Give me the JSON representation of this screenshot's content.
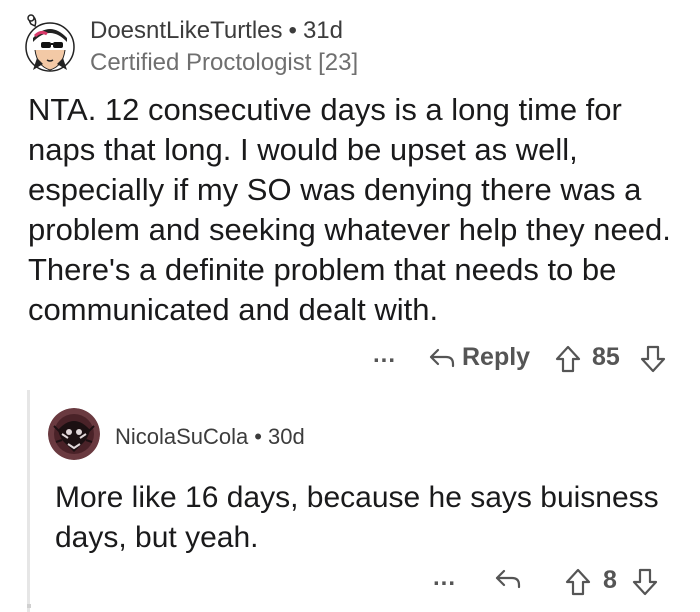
{
  "comment": {
    "author": "DoesntLikeTurtles",
    "separator": "•",
    "age": "31d",
    "flair": "Certified Proctologist [23]",
    "body": "NTA. 12 consecutive days is a long time for naps that long. I would be upset as well, especially if my SO was denying there was a problem and seeking whatever help they need. There's a definite problem that needs to be communicated and dealt with.",
    "actions": {
      "more_label": "...",
      "reply_label": "Reply",
      "score": "85"
    }
  },
  "reply": {
    "author": "NicolaSuCola",
    "separator": "•",
    "age": "30d",
    "body": "More like 16 days, because he says buisness days, but yeah.",
    "actions": {
      "more_label": "...",
      "score": "8"
    }
  },
  "icons": {
    "reply": "reply-arrow-icon",
    "upvote": "upvote-arrow-icon",
    "downvote": "downvote-arrow-icon",
    "more": "more-dots-icon"
  },
  "colors": {
    "text": "#1a1a1b",
    "meta": "#6f6f6f",
    "action": "#555555",
    "thread_line": "#e6e6e6"
  }
}
